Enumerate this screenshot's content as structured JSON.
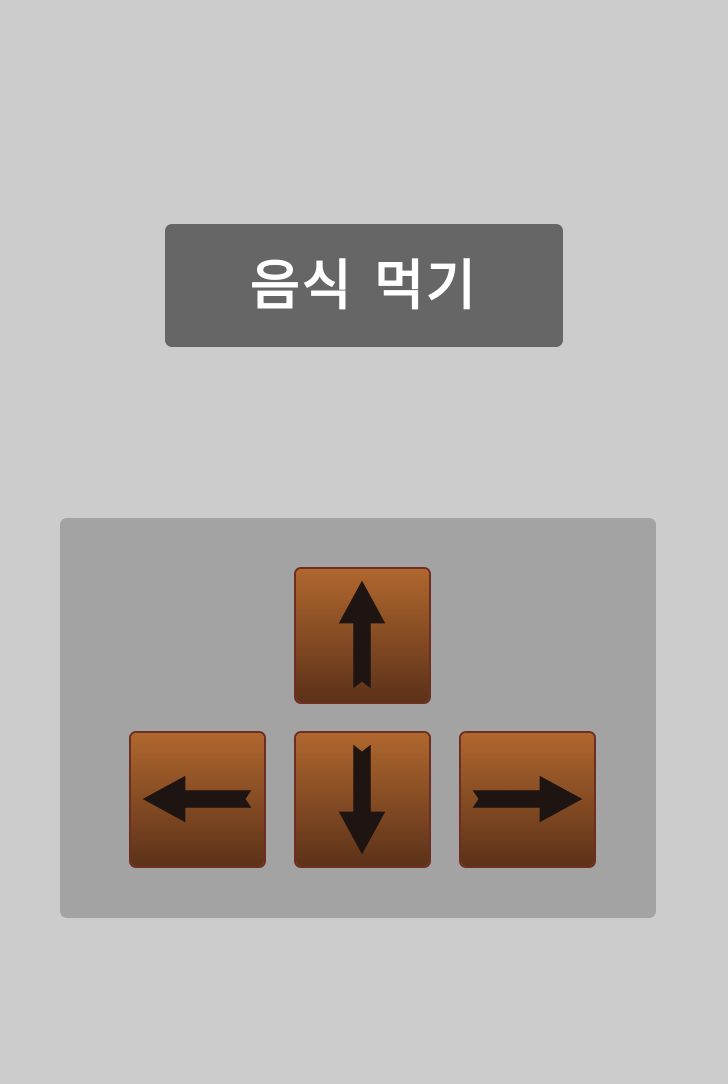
{
  "title": {
    "text": "음식 먹기"
  },
  "colors": {
    "background": "#cccccc",
    "banner": "#666666",
    "banner_text": "#ffffff",
    "pad": "#a3a3a3",
    "key_top": "#b0672e",
    "key_bottom": "#5c3219",
    "key_border": "#6e2e22",
    "arrow": "#1e1412"
  },
  "controls": {
    "keys": [
      {
        "direction": "up",
        "icon": "arrow-up-icon"
      },
      {
        "direction": "left",
        "icon": "arrow-left-icon"
      },
      {
        "direction": "down",
        "icon": "arrow-down-icon"
      },
      {
        "direction": "right",
        "icon": "arrow-right-icon"
      }
    ]
  }
}
